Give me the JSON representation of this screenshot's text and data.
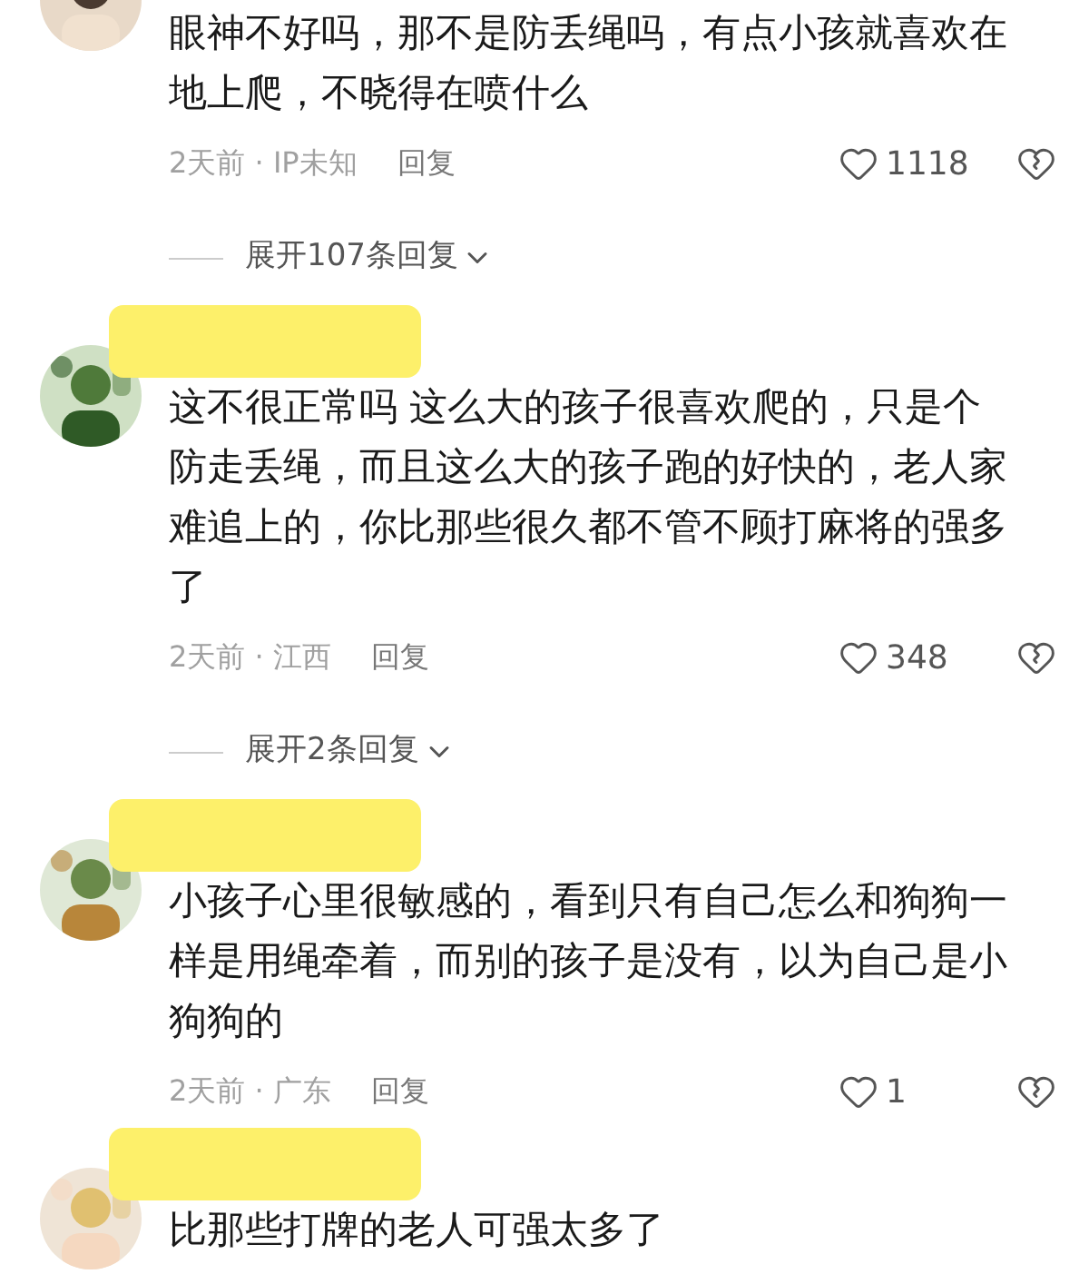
{
  "comments": [
    {
      "text": "眼神不好吗，那不是防丢绳吗，有点小孩就喜欢在地上爬，不晓得在喷什么",
      "meta": "2天前 · IP未知",
      "reply": "回复",
      "likes": "1118",
      "expand": "展开107条回复"
    },
    {
      "redacted_name": true,
      "text": "这不很正常吗 这么大的孩子很喜欢爬的，只是个防走丢绳，而且这么大的孩子跑的好快的，老人家难追上的，你比那些很久都不管不顾打麻将的强多了",
      "meta": "2天前 · 江西",
      "reply": "回复",
      "likes": "348",
      "expand": "展开2条回复"
    },
    {
      "redacted_name": true,
      "text": "小孩子心里很敏感的，看到只有自己怎么和狗狗一样是用绳牵着，而别的孩子是没有，以为自己是小狗狗的",
      "meta": "2天前 · 广东",
      "reply": "回复",
      "likes": "1"
    },
    {
      "redacted_name": true,
      "text": "比那些打牌的老人可强太多了"
    }
  ]
}
